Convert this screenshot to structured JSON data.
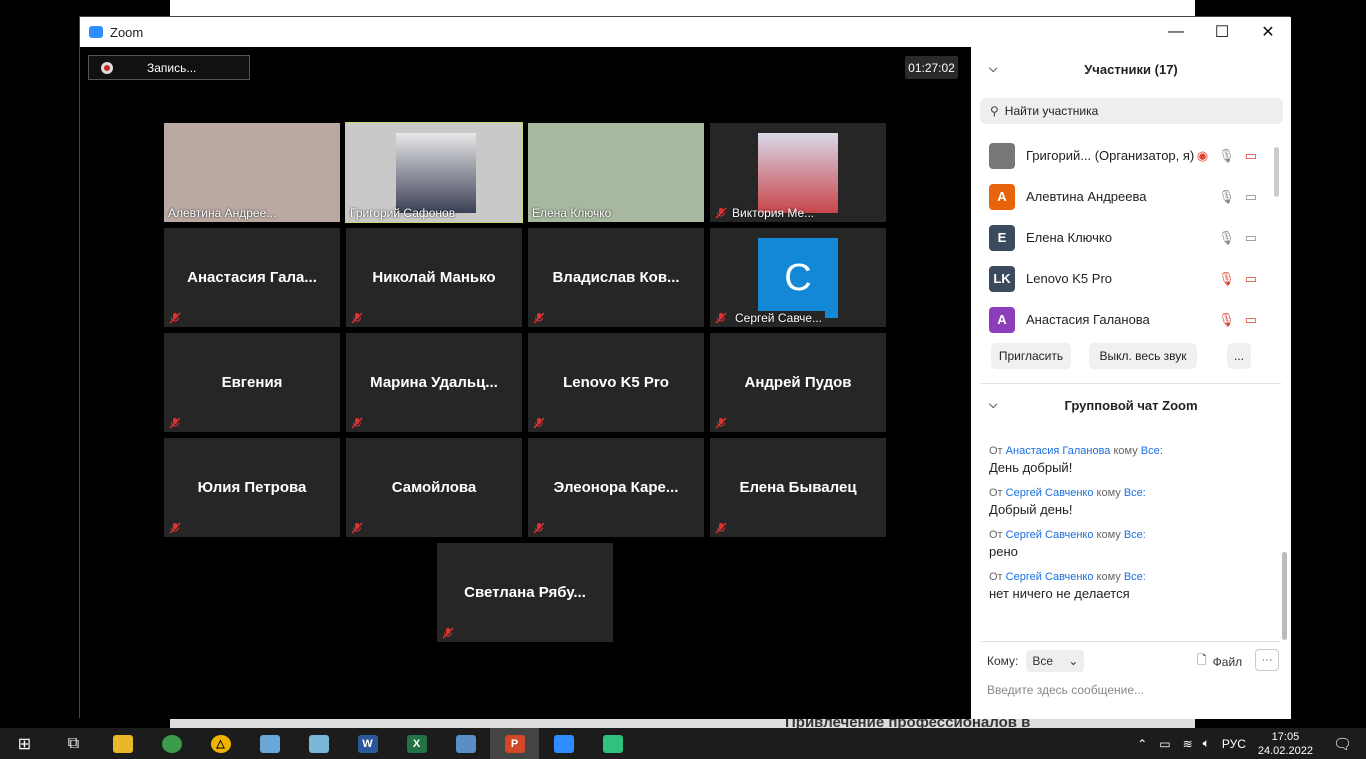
{
  "window": {
    "title": "Zoom",
    "minimize": "—",
    "maximize": "☐",
    "close": "✕"
  },
  "recording": {
    "label": "Запись..."
  },
  "timer": "01:27:02",
  "tiles": [
    {
      "name": "Алевтина Андрее...",
      "video": true,
      "muted": false
    },
    {
      "name": "Григорий Сафонов",
      "video": true,
      "muted": false,
      "active": true
    },
    {
      "name": "Елена Ключко",
      "video": true,
      "muted": false
    },
    {
      "name": "Виктория Ме...",
      "video": true,
      "muted": true
    },
    {
      "name": "Анастасия  Гала...",
      "video": false,
      "muted": true
    },
    {
      "name": "Николай Манько",
      "video": false,
      "muted": true
    },
    {
      "name": "Владислав  Ков...",
      "video": false,
      "muted": true
    },
    {
      "name": "Сергей Савче...",
      "video": true,
      "muted": true,
      "avatar": "С"
    },
    {
      "name": "Евгения",
      "video": false,
      "muted": true
    },
    {
      "name": "Марина  Удальц...",
      "video": false,
      "muted": true
    },
    {
      "name": "Lenovo K5 Pro",
      "video": false,
      "muted": true
    },
    {
      "name": "Андрей Пудов",
      "video": false,
      "muted": true
    },
    {
      "name": "Юлия Петрова",
      "video": false,
      "muted": true
    },
    {
      "name": "Самойлова",
      "video": false,
      "muted": true
    },
    {
      "name": "Элеонора  Каре...",
      "video": false,
      "muted": true
    },
    {
      "name": "Елена Бывалец",
      "video": false,
      "muted": true
    },
    {
      "name": "Светлана  Рябу...",
      "video": false,
      "muted": true
    }
  ],
  "participants": {
    "header": "Участники (17)",
    "search_placeholder": "Найти участника",
    "list": [
      {
        "initials": "",
        "name": "Григорий...  (Организатор, я)",
        "color": "#777",
        "mic": "on",
        "cam": "off"
      },
      {
        "initials": "A",
        "name": "Алевтина Андреева",
        "color": "#e8640c",
        "mic": "on",
        "cam": "on"
      },
      {
        "initials": "E",
        "name": "Елена Ключко",
        "color": "#3c4a5e",
        "mic": "on",
        "cam": "on"
      },
      {
        "initials": "LK",
        "name": "Lenovo K5 Pro",
        "color": "#3c4a5e",
        "mic": "off",
        "cam": "off"
      },
      {
        "initials": "A",
        "name": "Анастасия Галанова",
        "color": "#8b3dba",
        "mic": "off",
        "cam": "off"
      }
    ],
    "invite": "Пригласить",
    "mute_all": "Выкл. весь звук",
    "more": "..."
  },
  "chat": {
    "header": "Групповой чат Zoom",
    "from_word": "От",
    "to_word": "кому",
    "messages": [
      {
        "from": "Анастасия Галанова",
        "to": "Все:",
        "text": "День добрый!"
      },
      {
        "from": "Сергей Савченко",
        "to": "Все:",
        "text": "Добрый день!"
      },
      {
        "from": "Сергей Савченко",
        "to": "Все:",
        "text": "рено"
      },
      {
        "from": "Сергей Савченко",
        "to": "Все:",
        "text": "нет ничего не делается"
      }
    ],
    "to_label": "Кому:",
    "to_value": "Все",
    "file_label": "Файл",
    "more": "···",
    "input_placeholder": "Введите здесь сообщение..."
  },
  "background_text": "Привлечение профессионалов в",
  "taskbar": {
    "language": "РУС",
    "time": "17:05",
    "date": "24.02.2022"
  }
}
